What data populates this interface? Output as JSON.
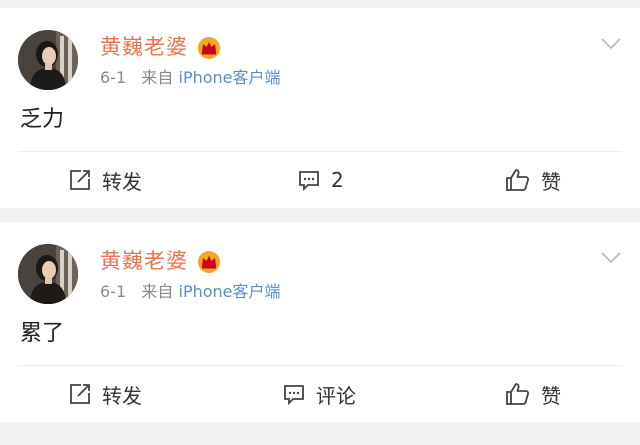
{
  "posts": [
    {
      "username": "黄巍老婆",
      "date": "6-1",
      "source_prefix": "来自",
      "source": "iPhone客户端",
      "content": "乏力",
      "actions": {
        "repost": "转发",
        "comment": "2",
        "like": "赞"
      }
    },
    {
      "username": "黄巍老婆",
      "date": "6-1",
      "source_prefix": "来自",
      "source": "iPhone客户端",
      "content": "累了",
      "actions": {
        "repost": "转发",
        "comment": "评论",
        "like": "赞"
      }
    }
  ],
  "colors": {
    "username": "#eb7350",
    "source": "#5d8fc6",
    "crown": "#f5a623"
  },
  "icons": [
    "avatar-photo",
    "vip-crown-icon",
    "chevron-down-icon",
    "repost-icon",
    "comment-icon",
    "like-icon"
  ]
}
